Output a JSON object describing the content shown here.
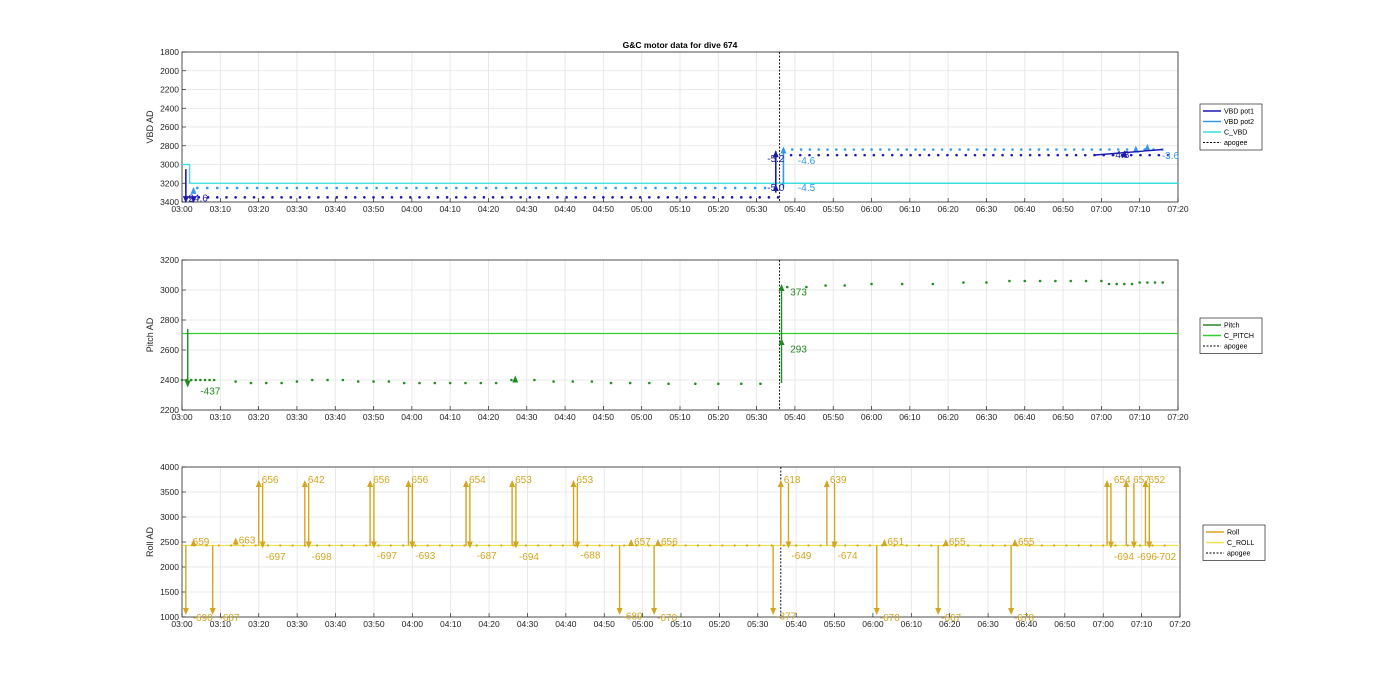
{
  "title": "G&C motor data for dive 674",
  "x_ticks": [
    "03:00",
    "03:10",
    "03:20",
    "03:30",
    "03:40",
    "03:50",
    "04:00",
    "04:10",
    "04:20",
    "04:30",
    "04:40",
    "04:50",
    "05:00",
    "05:10",
    "05:20",
    "05:30",
    "05:40",
    "05:50",
    "06:00",
    "06:10",
    "06:20",
    "06:30",
    "06:40",
    "06:50",
    "07:00",
    "07:10",
    "07:20"
  ],
  "colors": {
    "vbd_pot1": "#1a1ab0",
    "vbd_pot2": "#3399ee",
    "c_vbd": "#33dddd",
    "pitch": "#228b22",
    "c_pitch": "#33cc33",
    "roll": "#d4a520",
    "c_roll": "#f0e050",
    "apogee": "#000000"
  },
  "chart_data": [
    {
      "type": "line",
      "ylabel": "VBD AD",
      "xlim": [
        "03:00",
        "07:20"
      ],
      "ylim": [
        3400,
        1800
      ],
      "y_reversed": true,
      "y_ticks": [
        1800,
        2000,
        2200,
        2400,
        2600,
        2800,
        3000,
        3200,
        3400
      ],
      "y_tick_labels": [
        "1800",
        "2000",
        "2200",
        "2400",
        "2600",
        "2800",
        "3000",
        "3200",
        "3400"
      ],
      "grid": true,
      "legend_position": "right",
      "legend": [
        "VBD pot1",
        "VBD pot2",
        "C_VBD",
        "apogee"
      ],
      "series": [
        {
          "name": "C_VBD",
          "values": [
            [
              0,
              3000
            ],
            [
              2,
              3000
            ],
            [
              2,
              3200
            ],
            [
              260,
              3200
            ]
          ]
        },
        {
          "name": "apogee",
          "x_minutes": 156
        },
        {
          "name": "VBD pot1 points",
          "x_minutes_range": [
            2,
            258
          ],
          "y": 3350
        },
        {
          "name": "VBD pot2 points",
          "x_minutes_range": [
            4,
            258
          ],
          "y": 3250
        }
      ],
      "annotations": [
        {
          "text": "-24.6",
          "x": 0,
          "y": 3350,
          "color": "vbd_pot1"
        },
        {
          "text": "-5.2",
          "x": 152,
          "y": 2930,
          "color": "vbd_pot1"
        },
        {
          "text": "-5.0",
          "x": 152,
          "y": 3240,
          "color": "vbd_pot1"
        },
        {
          "text": "-4.6",
          "x": 160,
          "y": 2950,
          "color": "vbd_pot2"
        },
        {
          "text": "-4.5",
          "x": 160,
          "y": 3240,
          "color": "vbd_pot2"
        },
        {
          "text": "-3.6",
          "x": 255,
          "y": 2900,
          "color": "vbd_pot2"
        },
        {
          "text": "-4.8",
          "x": 242,
          "y": 2890,
          "color": "vbd_pot1"
        }
      ]
    },
    {
      "type": "line",
      "ylabel": "Pitch AD",
      "xlim": [
        "03:00",
        "07:20"
      ],
      "ylim": [
        2200,
        3200
      ],
      "y_ticks": [
        2200,
        2400,
        2600,
        2800,
        3000,
        3200
      ],
      "y_tick_labels": [
        "2200",
        "2400",
        "2600",
        "2800",
        "3000",
        "3200"
      ],
      "grid": true,
      "legend_position": "right",
      "legend": [
        "Pitch",
        "C_PITCH",
        "apogee"
      ],
      "series": [
        {
          "name": "C_PITCH",
          "values": [
            [
              0,
              2710
            ],
            [
              260,
              2710
            ]
          ]
        },
        {
          "name": "apogee",
          "x_minutes": 156
        }
      ],
      "annotations": [
        {
          "text": "-437",
          "x": 4,
          "y": 2330,
          "color": "pitch"
        },
        {
          "text": "293",
          "x": 158,
          "y": 2610,
          "color": "pitch"
        },
        {
          "text": "373",
          "x": 158,
          "y": 2990,
          "color": "pitch"
        }
      ]
    },
    {
      "type": "line",
      "ylabel": "Roll AD",
      "xlim": [
        "03:00",
        "07:20"
      ],
      "ylim": [
        1000,
        4000
      ],
      "y_ticks": [
        1000,
        1500,
        2000,
        2500,
        3000,
        3500,
        4000
      ],
      "y_tick_labels": [
        "1000",
        "1500",
        "2000",
        "2500",
        "3000",
        "3500",
        "4000"
      ],
      "grid": true,
      "legend_position": "right",
      "legend": [
        "Roll",
        "C_ROLL",
        "apogee"
      ],
      "series": [
        {
          "name": "C_ROLL",
          "values": [
            [
              0,
              2430
            ],
            [
              260,
              2430
            ]
          ]
        },
        {
          "name": "apogee",
          "x_minutes": 156
        }
      ],
      "annotations": [
        {
          "text": "659",
          "x": 2,
          "y": 2520
        },
        {
          "text": "-690",
          "x": 2,
          "y": 1000
        },
        {
          "text": "-687",
          "x": 9,
          "y": 1000
        },
        {
          "text": "663",
          "x": 14,
          "y": 2550
        },
        {
          "text": "656",
          "x": 20,
          "y": 3760
        },
        {
          "text": "-697",
          "x": 21,
          "y": 2220
        },
        {
          "text": "642",
          "x": 32,
          "y": 3760
        },
        {
          "text": "-698",
          "x": 33,
          "y": 2220
        },
        {
          "text": "656",
          "x": 49,
          "y": 3760
        },
        {
          "text": "-697",
          "x": 50,
          "y": 2240
        },
        {
          "text": "656",
          "x": 59,
          "y": 3760
        },
        {
          "text": "-693",
          "x": 60,
          "y": 2240
        },
        {
          "text": "654",
          "x": 74,
          "y": 3760
        },
        {
          "text": "-687",
          "x": 76,
          "y": 2240
        },
        {
          "text": "653",
          "x": 86,
          "y": 3760
        },
        {
          "text": "-694",
          "x": 87,
          "y": 2220
        },
        {
          "text": "653",
          "x": 102,
          "y": 3760
        },
        {
          "text": "-688",
          "x": 103,
          "y": 2250
        },
        {
          "text": "657",
          "x": 117,
          "y": 2520
        },
        {
          "text": "-689",
          "x": 114,
          "y": 1030
        },
        {
          "text": "656",
          "x": 124,
          "y": 2520
        },
        {
          "text": "-670",
          "x": 123,
          "y": 1000
        },
        {
          "text": "618",
          "x": 156,
          "y": 3760
        },
        {
          "text": "-649",
          "x": 158,
          "y": 2240
        },
        {
          "text": "-377",
          "x": 154,
          "y": 1030
        },
        {
          "text": "639",
          "x": 168,
          "y": 3760
        },
        {
          "text": "-674",
          "x": 170,
          "y": 2240
        },
        {
          "text": "651",
          "x": 183,
          "y": 2520
        },
        {
          "text": "-670",
          "x": 181,
          "y": 1000
        },
        {
          "text": "655",
          "x": 199,
          "y": 2520
        },
        {
          "text": "-667",
          "x": 197,
          "y": 1000
        },
        {
          "text": "655",
          "x": 217,
          "y": 2520
        },
        {
          "text": "-678",
          "x": 216,
          "y": 1000
        },
        {
          "text": "654",
          "x": 242,
          "y": 3760
        },
        {
          "text": "-694",
          "x": 242,
          "y": 2220
        },
        {
          "text": "657",
          "x": 247,
          "y": 3760
        },
        {
          "text": "-696",
          "x": 248,
          "y": 2220
        },
        {
          "text": "652",
          "x": 251,
          "y": 3760
        },
        {
          "text": "-702",
          "x": 253,
          "y": 2220
        }
      ]
    }
  ],
  "legends": [
    {
      "items": [
        "VBD pot1",
        "VBD pot2",
        "C_VBD",
        "apogee"
      ]
    },
    {
      "items": [
        "Pitch",
        "C_PITCH",
        "apogee"
      ]
    },
    {
      "items": [
        "Roll",
        "C_ROLL",
        "apogee"
      ]
    }
  ]
}
